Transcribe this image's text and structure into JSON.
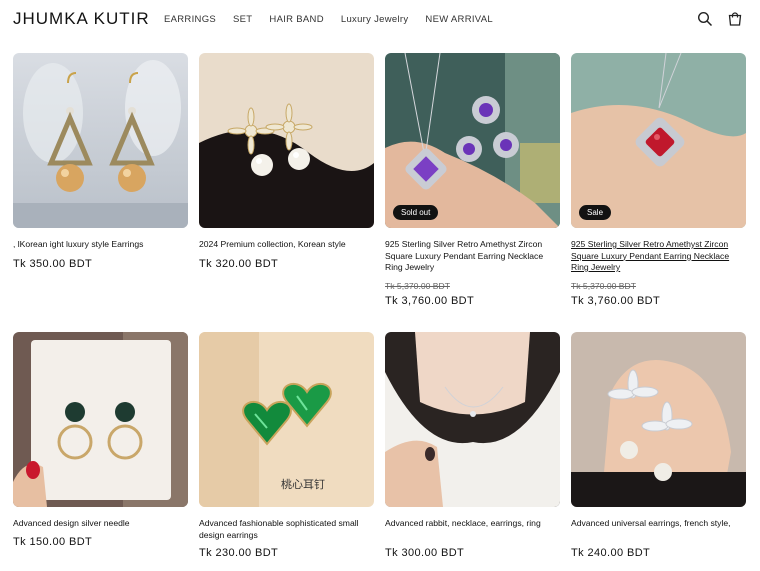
{
  "header": {
    "logo": "JHUMKA KUTIR",
    "nav": [
      "EARRINGS",
      "SET",
      "HAIR BAND",
      "Luxury Jewelry",
      "NEW ARRIVAL"
    ],
    "icons": [
      "search-icon",
      "cart-icon"
    ]
  },
  "products": [
    {
      "title": ", lKorean ight luxury style Earrings",
      "price": "Tk 350.00 BDT"
    },
    {
      "title": "2024 Premium collection, Korean style",
      "price": "Tk 320.00 BDT"
    },
    {
      "title": "925 Sterling Silver Retro Amethyst Zircon Square Luxury Pendant Earring Necklace Ring Jewelry",
      "badge": "Sold out",
      "old_price": "Tk 5,370.00 BDT",
      "price": "Tk 3,760.00 BDT"
    },
    {
      "title": "925 Sterling Silver Retro Amethyst Zircon Square Luxury Pendant Earring Necklace Ring Jewelry",
      "badge": "Sale",
      "old_price": "Tk 5,370.00 BDT",
      "price": "Tk 3,760.00 BDT"
    },
    {
      "title": "Advanced design silver needle",
      "price": "Tk 150.00 BDT"
    },
    {
      "title": "Advanced fashionable sophisticated small design earrings",
      "price": "Tk 230.00 BDT"
    },
    {
      "title": "Advanced rabbit, necklace, earrings, ring",
      "price": "Tk 300.00 BDT"
    },
    {
      "title": "Advanced universal earrings, french style,",
      "price": "Tk 240.00 BDT"
    }
  ],
  "image_text": {
    "card6": "桃心耳钉"
  }
}
